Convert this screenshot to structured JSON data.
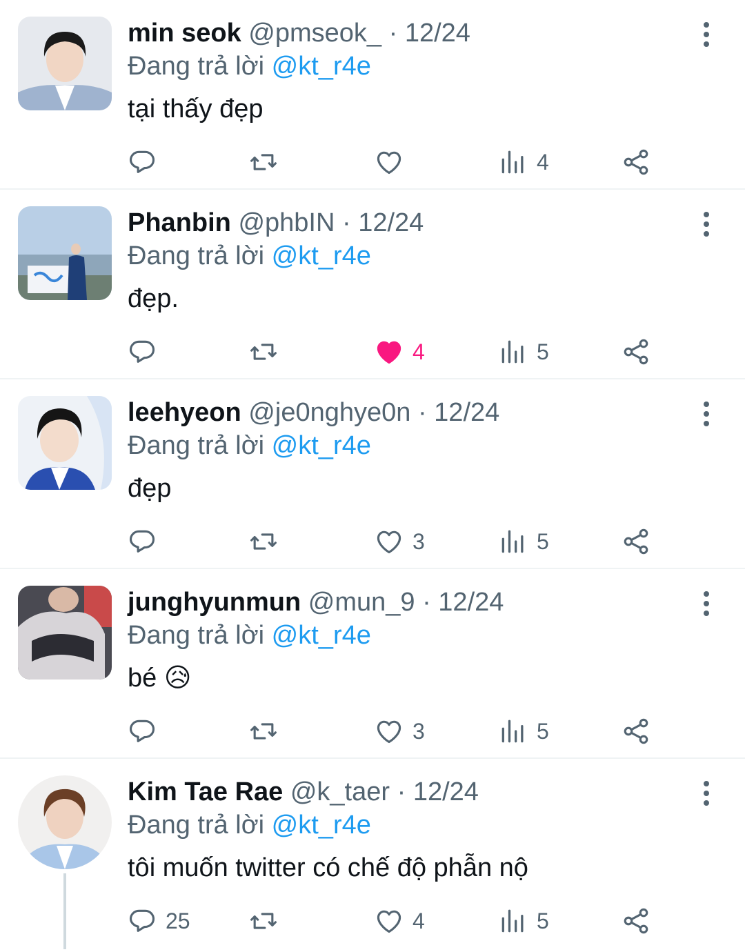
{
  "tweets": [
    {
      "name": "min seok",
      "handle": "@pmseok_",
      "dot": "·",
      "date": "12/24",
      "reply_prefix": "Đang trả lời",
      "reply_mention": "@kt_r4e",
      "text": "tại thấy đẹp",
      "replies": "",
      "retweets": "",
      "likes": "",
      "views": "4",
      "liked": false
    },
    {
      "name": "Phanbin",
      "handle": "@phbIN",
      "dot": "·",
      "date": "12/24",
      "reply_prefix": "Đang trả lời",
      "reply_mention": "@kt_r4e",
      "text": "đẹp.",
      "replies": "",
      "retweets": "",
      "likes": "4",
      "views": "5",
      "liked": true
    },
    {
      "name": "leehyeon",
      "handle": "@je0nghye0n",
      "dot": "·",
      "date": "12/24",
      "reply_prefix": "Đang trả lời",
      "reply_mention": "@kt_r4e",
      "text": "đẹp",
      "replies": "",
      "retweets": "",
      "likes": "3",
      "views": "5",
      "liked": false
    },
    {
      "name": "junghyunmun",
      "handle": "@mun_9",
      "dot": "·",
      "date": "12/24",
      "reply_prefix": "Đang trả lời",
      "reply_mention": "@kt_r4e",
      "text": "bé 😥",
      "replies": "",
      "retweets": "",
      "likes": "3",
      "views": "5",
      "liked": false
    },
    {
      "name": "Kim Tae Rae",
      "handle": "@k_taer",
      "dot": "·",
      "date": "12/24",
      "reply_prefix": "Đang trả lời",
      "reply_mention": "@kt_r4e",
      "text": "tôi muốn twitter có chế độ phẫn nộ",
      "replies": "25",
      "retweets": "",
      "likes": "4",
      "views": "5",
      "liked": false
    }
  ],
  "colors": {
    "text": "#0f1419",
    "secondary": "#536471",
    "mention": "#1d9bf0",
    "like_active": "#f91880",
    "divider": "#eff3f4"
  },
  "icons": [
    "reply-icon",
    "retweet-icon",
    "like-icon",
    "views-icon",
    "share-icon",
    "more-icon"
  ]
}
